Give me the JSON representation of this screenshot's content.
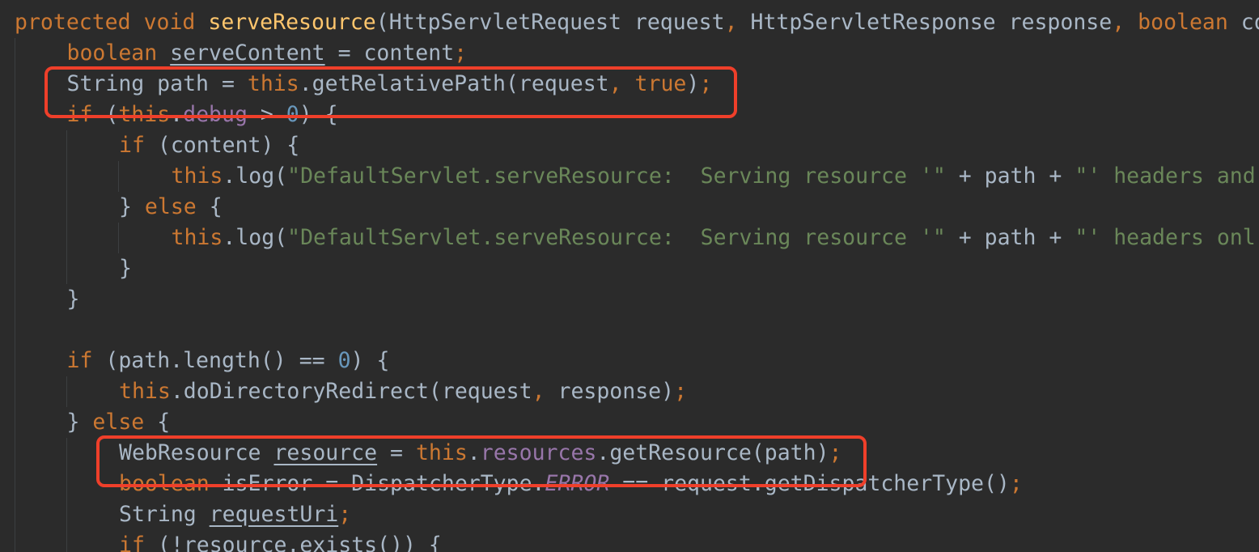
{
  "editor": {
    "language": "Java",
    "colors": {
      "background": "#2b2b2b",
      "keyword": "#cc7832",
      "method_declaration": "#ffc66d",
      "string": "#6a8759",
      "number": "#6897bb",
      "field": "#9876aa",
      "default_text": "#a9b7c6",
      "highlight_box": "#ef3f2a"
    },
    "highlights": [
      {
        "label": "getRelativePath line",
        "line": 3
      },
      {
        "label": "getResource line",
        "line": 15
      }
    ],
    "lines": [
      {
        "indent": 0,
        "tokens": [
          {
            "text": "protected",
            "style": "kw"
          },
          {
            "text": " ",
            "style": "plain"
          },
          {
            "text": "void",
            "style": "kw"
          },
          {
            "text": " ",
            "style": "plain"
          },
          {
            "text": "serveResource",
            "style": "fn"
          },
          {
            "text": "(HttpServletRequest request",
            "style": "plain"
          },
          {
            "text": ",",
            "style": "kw"
          },
          {
            "text": " HttpServletResponse response",
            "style": "plain"
          },
          {
            "text": ",",
            "style": "kw"
          },
          {
            "text": " ",
            "style": "plain"
          },
          {
            "text": "boolean",
            "style": "kw"
          },
          {
            "text": " co",
            "style": "plain"
          }
        ]
      },
      {
        "indent": 1,
        "tokens": [
          {
            "text": "boolean",
            "style": "kw"
          },
          {
            "text": " ",
            "style": "plain"
          },
          {
            "text": "serveContent",
            "style": "plain ul"
          },
          {
            "text": " = content",
            "style": "plain"
          },
          {
            "text": ";",
            "style": "kw"
          }
        ]
      },
      {
        "indent": 1,
        "tokens": [
          {
            "text": "String path = ",
            "style": "plain"
          },
          {
            "text": "this",
            "style": "kw"
          },
          {
            "text": ".getRelativePath(request",
            "style": "plain"
          },
          {
            "text": ",",
            "style": "kw"
          },
          {
            "text": " ",
            "style": "plain"
          },
          {
            "text": "true",
            "style": "kw"
          },
          {
            "text": ")",
            "style": "plain"
          },
          {
            "text": ";",
            "style": "kw"
          }
        ]
      },
      {
        "indent": 1,
        "tokens": [
          {
            "text": "if",
            "style": "kw"
          },
          {
            "text": " (",
            "style": "plain"
          },
          {
            "text": "this",
            "style": "kw"
          },
          {
            "text": ".",
            "style": "plain"
          },
          {
            "text": "debug",
            "style": "fld"
          },
          {
            "text": " > ",
            "style": "plain"
          },
          {
            "text": "0",
            "style": "num"
          },
          {
            "text": ") {",
            "style": "plain"
          }
        ]
      },
      {
        "indent": 2,
        "tokens": [
          {
            "text": "if",
            "style": "kw"
          },
          {
            "text": " (content) {",
            "style": "plain"
          }
        ]
      },
      {
        "indent": 3,
        "tokens": [
          {
            "text": "this",
            "style": "kw"
          },
          {
            "text": ".log(",
            "style": "plain"
          },
          {
            "text": "\"DefaultServlet.serveResource:  Serving resource '\"",
            "style": "str"
          },
          {
            "text": " + path + ",
            "style": "plain"
          },
          {
            "text": "\"' headers and",
            "style": "str"
          }
        ]
      },
      {
        "indent": 2,
        "tokens": [
          {
            "text": "} ",
            "style": "plain"
          },
          {
            "text": "else",
            "style": "kw"
          },
          {
            "text": " {",
            "style": "plain"
          }
        ]
      },
      {
        "indent": 3,
        "tokens": [
          {
            "text": "this",
            "style": "kw"
          },
          {
            "text": ".log(",
            "style": "plain"
          },
          {
            "text": "\"DefaultServlet.serveResource:  Serving resource '\"",
            "style": "str"
          },
          {
            "text": " + path + ",
            "style": "plain"
          },
          {
            "text": "\"' headers onl",
            "style": "str"
          }
        ]
      },
      {
        "indent": 2,
        "tokens": [
          {
            "text": "}",
            "style": "plain"
          }
        ]
      },
      {
        "indent": 1,
        "tokens": [
          {
            "text": "}",
            "style": "plain"
          }
        ]
      },
      {
        "indent": 0,
        "tokens": []
      },
      {
        "indent": 1,
        "tokens": [
          {
            "text": "if",
            "style": "kw"
          },
          {
            "text": " (path.length() == ",
            "style": "plain"
          },
          {
            "text": "0",
            "style": "num"
          },
          {
            "text": ") {",
            "style": "plain"
          }
        ]
      },
      {
        "indent": 2,
        "tokens": [
          {
            "text": "this",
            "style": "kw"
          },
          {
            "text": ".doDirectoryRedirect(request",
            "style": "plain"
          },
          {
            "text": ",",
            "style": "kw"
          },
          {
            "text": " response)",
            "style": "plain"
          },
          {
            "text": ";",
            "style": "kw"
          }
        ]
      },
      {
        "indent": 1,
        "tokens": [
          {
            "text": "} ",
            "style": "plain"
          },
          {
            "text": "else",
            "style": "kw"
          },
          {
            "text": " {",
            "style": "plain"
          }
        ]
      },
      {
        "indent": 2,
        "tokens": [
          {
            "text": "WebResource ",
            "style": "plain"
          },
          {
            "text": "resource",
            "style": "plain ul"
          },
          {
            "text": " = ",
            "style": "plain"
          },
          {
            "text": "this",
            "style": "kw"
          },
          {
            "text": ".",
            "style": "plain"
          },
          {
            "text": "resources",
            "style": "fld"
          },
          {
            "text": ".getResource(path)",
            "style": "plain"
          },
          {
            "text": ";",
            "style": "kw"
          }
        ]
      },
      {
        "indent": 2,
        "tokens": [
          {
            "text": "boolean",
            "style": "kw"
          },
          {
            "text": " isError = DispatcherType.",
            "style": "plain"
          },
          {
            "text": "ERROR",
            "style": "fld-i"
          },
          {
            "text": " == request.getDispatcherType()",
            "style": "plain"
          },
          {
            "text": ";",
            "style": "kw"
          }
        ]
      },
      {
        "indent": 2,
        "tokens": [
          {
            "text": "String ",
            "style": "plain"
          },
          {
            "text": "requestUri",
            "style": "plain ul"
          },
          {
            "text": ";",
            "style": "kw"
          }
        ]
      },
      {
        "indent": 2,
        "tokens": [
          {
            "text": "if",
            "style": "kw"
          },
          {
            "text": " (!resource.exists()) {",
            "style": "plain"
          }
        ]
      }
    ]
  }
}
